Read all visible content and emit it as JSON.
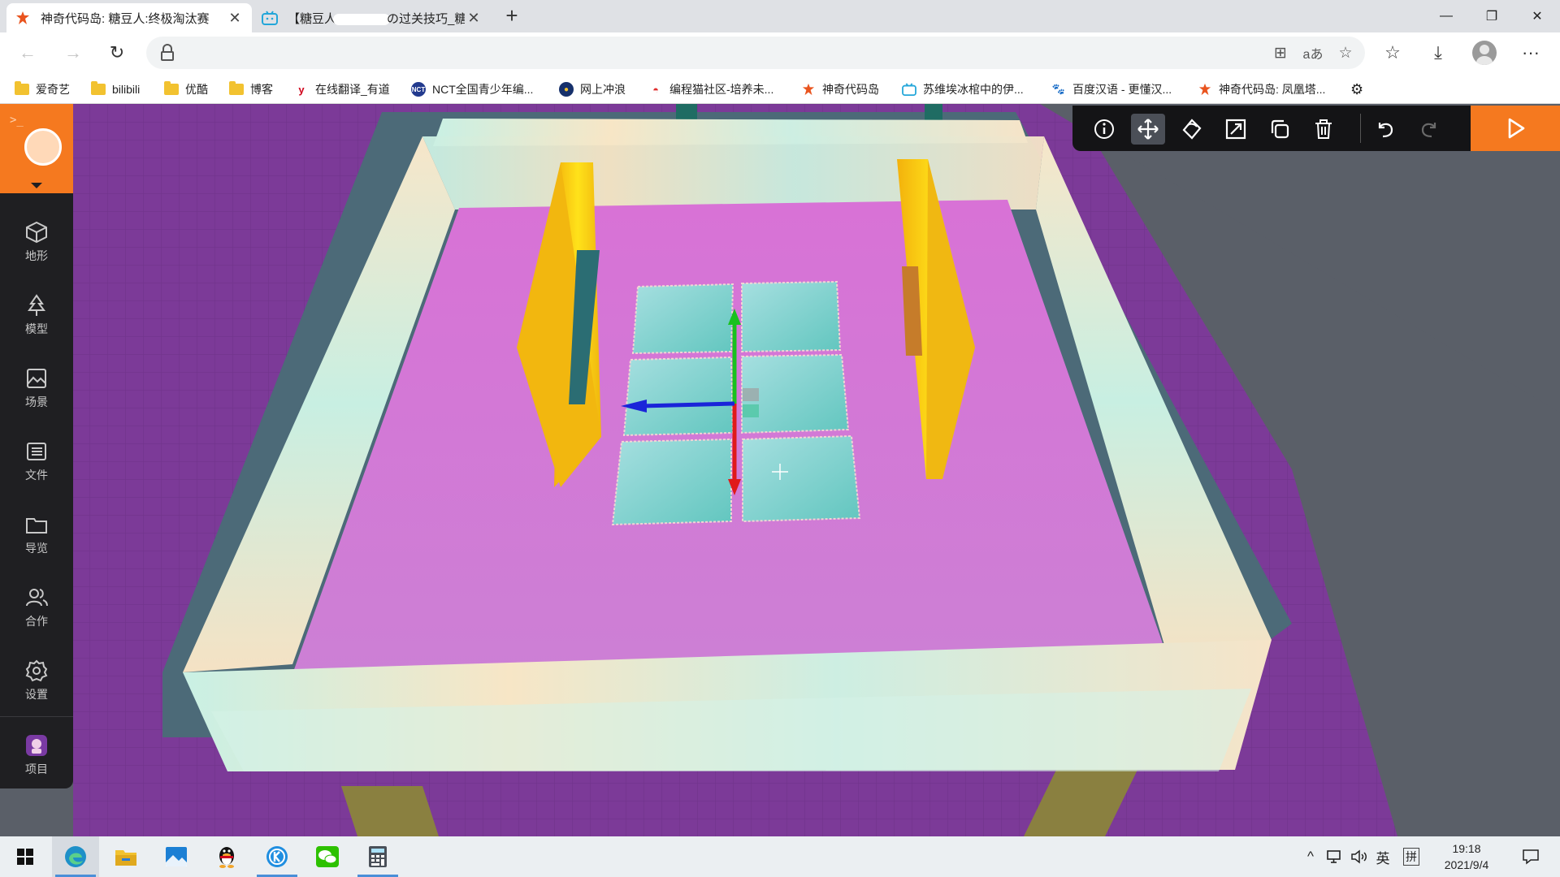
{
  "browser": {
    "tabs": [
      {
        "title": "神奇代码岛: 糖豆人:终极淘汰赛",
        "active": true,
        "icon": "codeisland-logo-icon"
      },
      {
        "title": "【糖豆人",
        "title_suffix": "の过关技巧_糖",
        "active": false,
        "icon": "bilibili-tv-icon"
      }
    ],
    "new_tab_label": "+",
    "window_controls": [
      "minimize-icon",
      "restore-icon",
      "close-icon"
    ],
    "address_bar": {
      "url": "",
      "placeholder": ""
    },
    "toolbar_icons": [
      "back-icon",
      "forward-icon",
      "refresh-icon",
      "lock-icon",
      "apps-icon",
      "read-aloud-icon",
      "favorite-add-icon",
      "favorites-icon",
      "download-icon",
      "profile-icon",
      "more-icon"
    ],
    "bookmarks": [
      {
        "label": "爱奇艺",
        "icon": "folder-icon"
      },
      {
        "label": "bilibili",
        "icon": "folder-icon"
      },
      {
        "label": "优酷",
        "icon": "folder-icon"
      },
      {
        "label": "博客",
        "icon": "folder-icon"
      },
      {
        "label": "在线翻译_有道",
        "icon": "youdao-icon"
      },
      {
        "label": "NCT全国青少年编...",
        "icon": "nct-icon"
      },
      {
        "label": "网上冲浪",
        "icon": "surf-icon"
      },
      {
        "label": "编程猫社区-培养未...",
        "icon": "codemao-icon"
      },
      {
        "label": "神奇代码岛",
        "icon": "codeisland-logo-icon"
      },
      {
        "label": "苏维埃冰棺中的伊...",
        "icon": "bilibili-tv-icon"
      },
      {
        "label": "百度汉语 - 更懂汉...",
        "icon": "baidu-icon"
      },
      {
        "label": "神奇代码岛: 凤凰塔...",
        "icon": "codeisland-logo-icon"
      }
    ]
  },
  "editor": {
    "sidebar": [
      {
        "label": "地形",
        "icon": "cube-icon"
      },
      {
        "label": "模型",
        "icon": "tree-icon"
      },
      {
        "label": "场景",
        "icon": "image-icon"
      },
      {
        "label": "文件",
        "icon": "list-icon"
      },
      {
        "label": "导览",
        "icon": "folder-icon"
      },
      {
        "label": "合作",
        "icon": "users-icon"
      },
      {
        "label": "设置",
        "icon": "gear-icon"
      },
      {
        "label": "项目",
        "icon": "project-avatar-icon"
      }
    ],
    "toolbar": [
      {
        "name": "info",
        "icon": "info-icon",
        "active": false
      },
      {
        "name": "move",
        "icon": "move-icon",
        "active": true
      },
      {
        "name": "rotate",
        "icon": "rotate-icon",
        "active": false
      },
      {
        "name": "scale",
        "icon": "scale-icon",
        "active": false
      },
      {
        "name": "copy",
        "icon": "copy-icon",
        "active": false
      },
      {
        "name": "delete",
        "icon": "trash-icon",
        "active": false
      },
      {
        "name": "undo",
        "icon": "undo-icon",
        "active": false
      },
      {
        "name": "redo",
        "icon": "redo-icon",
        "active": false,
        "disabled": true
      }
    ],
    "play_icon": "play-icon",
    "accent": "#f5791f"
  },
  "taskbar": {
    "apps": [
      {
        "name": "start",
        "icon": "windows-icon"
      },
      {
        "name": "edge",
        "icon": "edge-icon",
        "active": true
      },
      {
        "name": "explorer",
        "icon": "file-explorer-icon"
      },
      {
        "name": "photos",
        "icon": "photos-icon"
      },
      {
        "name": "qq",
        "icon": "qq-penguin-icon"
      },
      {
        "name": "kugou",
        "icon": "kugou-icon"
      },
      {
        "name": "wechat",
        "icon": "wechat-icon"
      },
      {
        "name": "calculator",
        "icon": "calculator-icon"
      }
    ],
    "tray": {
      "chevron": "^",
      "ime_lang": "英",
      "ime_mode": "拼"
    },
    "time": "19:18",
    "date": "2021/9/4"
  }
}
